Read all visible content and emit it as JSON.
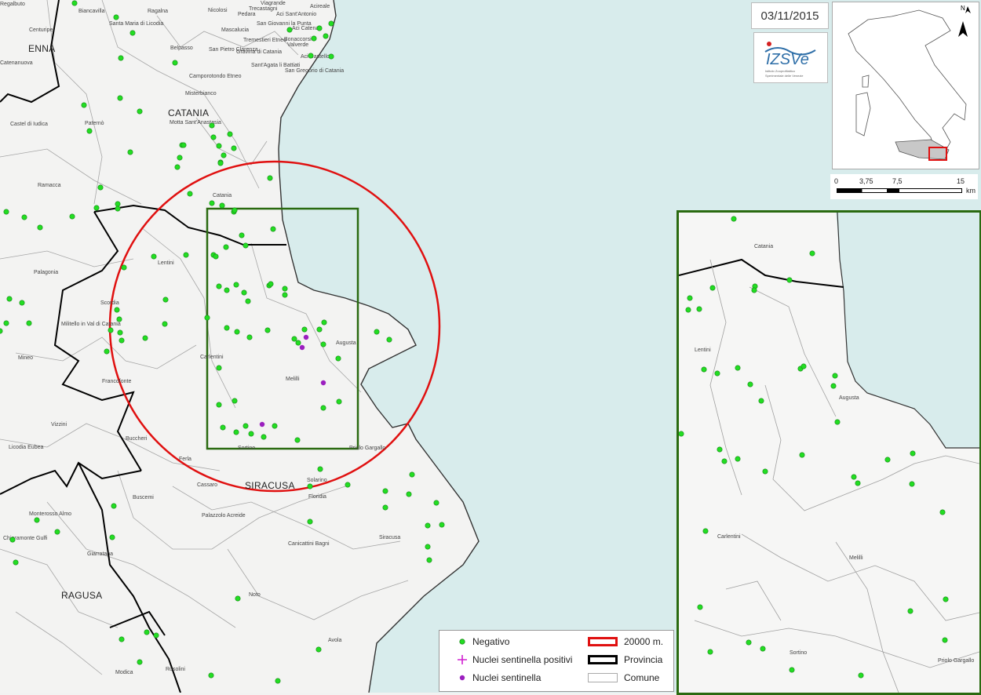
{
  "date": "03/11/2015",
  "logo": {
    "text": "IZSVe",
    "subtitle": "Istituto Zooprofilattico Sperimentale delle Venezie"
  },
  "north_arrow": "N",
  "scale": {
    "ticks": [
      "0",
      "3,75",
      "7,5",
      "15"
    ],
    "unit": "km"
  },
  "provinces": [
    "ENNA",
    "CATANIA",
    "SIRACUSA",
    "RAGUSA"
  ],
  "comuni": [
    "Regalbuto",
    "Biancavilla",
    "Ragalna",
    "Nicolosi",
    "Viagrande",
    "Trecastagni",
    "Aci Sant'Antonio",
    "Acireale",
    "Pedara",
    "Centuripe",
    "Santa Maria di Licodia",
    "Mascalucia",
    "San Giovanni la Punta",
    "Aci Catena",
    "Tremestieri Etneo",
    "San Pietro Clarenza",
    "Gravina di Catania",
    "Sant'Agata li Battiati",
    "San Gregorio di Catania",
    "Aci Castello",
    "Valverde",
    "Bonaccorsi",
    "Belpasso",
    "Camporotondo Etneo",
    "Misterbianco",
    "Paternò",
    "Motta Sant'Anastasia",
    "Castel di Iudica",
    "Catenanuova",
    "Ramacca",
    "Palagonia",
    "Lentini",
    "Scordia",
    "Militello in Val di Catania",
    "Mineo",
    "Carlentini",
    "Melilli",
    "Augusta",
    "Francofonte",
    "Vizzini",
    "Licodia Eubea",
    "Buccheri",
    "Ferla",
    "Sortino",
    "Priolo Gargallo",
    "Cassaro",
    "Solarino",
    "Floridia",
    "Buscemi",
    "Palazzolo Acreide",
    "Monterosso Almo",
    "Chiaramonte Gulfi",
    "Giarratana",
    "Canicattini Bagni",
    "Siracusa",
    "Noto",
    "Avola",
    "Modica",
    "Rosolini",
    "Catania"
  ],
  "inset_labels": [
    "Catania",
    "Lentini",
    "Augusta",
    "Carlentini",
    "Melilli",
    "Sortino",
    "Priolo Gargallo"
  ],
  "legend": {
    "negativo": "Negativo",
    "positivi": "Nuclei sentinella positivi",
    "sentinella": "Nuclei sentinella",
    "buffer": "20000 m.",
    "provincia": "Provincia",
    "comune": "Comune"
  },
  "colors": {
    "sea": "#d8ecec",
    "negativo": "#22dd22",
    "sentinella": "#9b1fbf",
    "buffer": "#e01010",
    "inset_frame": "#2a6a10",
    "province": "#000000",
    "comune": "#9a9a9a"
  },
  "counts": {
    "negativo_points": 140,
    "sentinella_points": 4,
    "positivi_points": 0
  }
}
